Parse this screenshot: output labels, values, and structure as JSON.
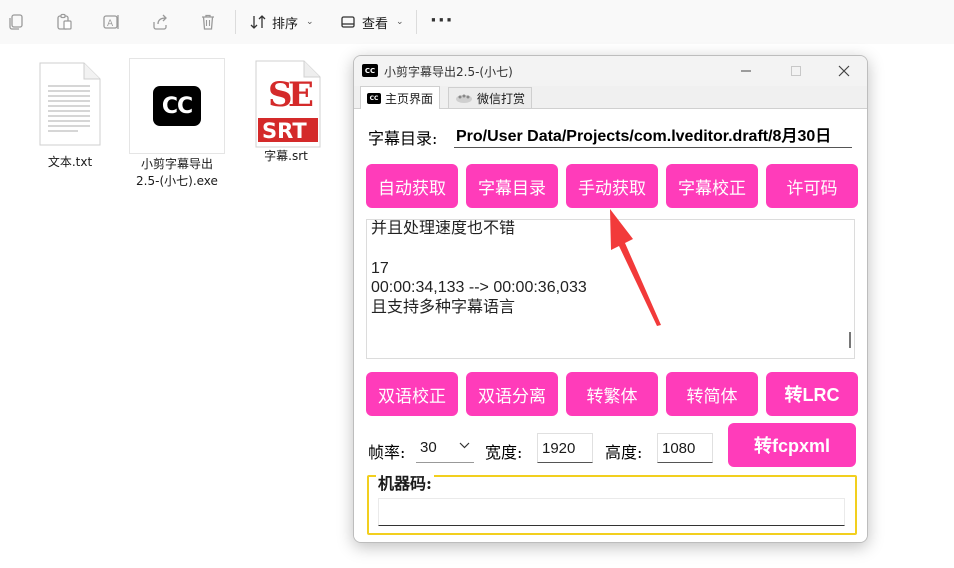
{
  "explorer": {
    "toolbar": {
      "sort_label": "排序",
      "view_label": "查看"
    },
    "files": [
      {
        "name": "文本.txt",
        "icon": "text-file-icon"
      },
      {
        "name_line1": "小剪字幕导出",
        "name_line2": "2.5-(小七).exe",
        "icon": "cc-app-icon"
      },
      {
        "name": "字幕.srt",
        "icon": "srt-file-icon"
      }
    ]
  },
  "window": {
    "title": "小剪字幕导出2.5-(小七)",
    "tabs": [
      {
        "label": "主页界面",
        "icon_text": "CC"
      },
      {
        "label": "微信打赏"
      }
    ],
    "subtitle_dir_label": "字幕目录:",
    "subtitle_dir_value": "Pro/User Data/Projects/com.lveditor.draft/8月30日",
    "row1_buttons": [
      "自动获取",
      "字幕目录",
      "手动获取",
      "字幕校正",
      "许可码"
    ],
    "text_lines": [
      "并且处理速度也不错",
      "",
      "17",
      "00:00:34,133 --> 00:00:36,033",
      "且支持多种字幕语言"
    ],
    "row2_buttons": [
      "双语校正",
      "双语分离",
      "转繁体",
      "转简体",
      "转LRC"
    ],
    "framerate_label": "帧率:",
    "framerate_value": "30",
    "width_label": "宽度:",
    "width_value": "1920",
    "height_label": "高度:",
    "height_value": "1080",
    "fcpxml_button": "转fcpxml",
    "machine_code_label": "机器码:",
    "machine_code_value": ""
  },
  "colors": {
    "accent": "#ff3cba",
    "fieldset_border": "#f2cf1e",
    "arrow": "#f23a3a"
  }
}
